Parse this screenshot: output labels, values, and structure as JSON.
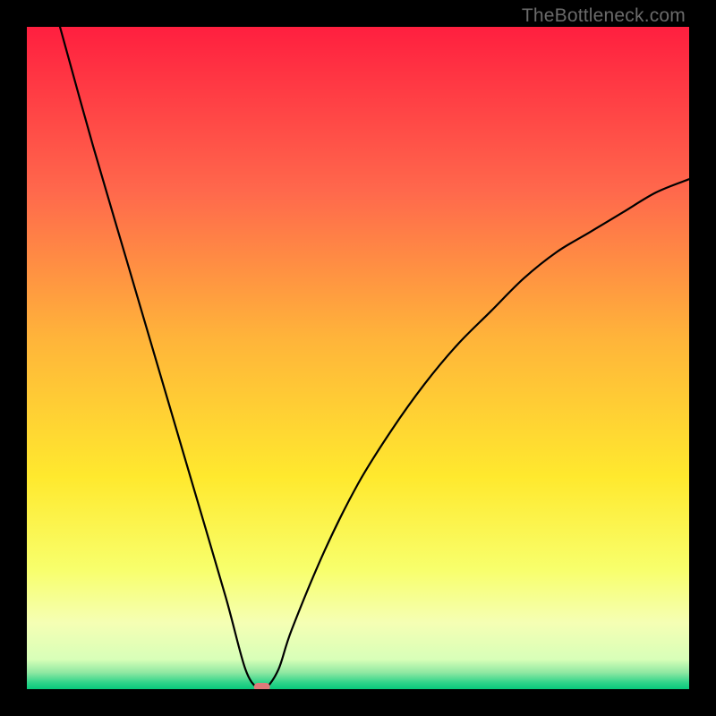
{
  "watermark": "TheBottleneck.com",
  "chart_data": {
    "type": "line",
    "title": "",
    "xlabel": "",
    "ylabel": "",
    "xlim": [
      0,
      100
    ],
    "ylim": [
      0,
      100
    ],
    "x": [
      5,
      10,
      15,
      20,
      25,
      30,
      33,
      35,
      36,
      38,
      40,
      45,
      50,
      55,
      60,
      65,
      70,
      75,
      80,
      85,
      90,
      95,
      100
    ],
    "values": [
      100,
      82,
      65,
      48,
      31,
      14,
      3,
      0,
      0,
      3,
      9,
      21,
      31,
      39,
      46,
      52,
      57,
      62,
      66,
      69,
      72,
      75,
      77
    ],
    "min_marker": {
      "x": 35.5,
      "y": 0
    },
    "gradient_stops": [
      {
        "pos": 0.0,
        "color": "#ff1f3f"
      },
      {
        "pos": 0.25,
        "color": "#ff694c"
      },
      {
        "pos": 0.47,
        "color": "#ffb43a"
      },
      {
        "pos": 0.68,
        "color": "#ffe92e"
      },
      {
        "pos": 0.82,
        "color": "#f8ff6c"
      },
      {
        "pos": 0.9,
        "color": "#f5ffb4"
      },
      {
        "pos": 0.955,
        "color": "#d8ffb8"
      },
      {
        "pos": 0.975,
        "color": "#8fe8a2"
      },
      {
        "pos": 0.99,
        "color": "#30d48a"
      },
      {
        "pos": 1.0,
        "color": "#08c97b"
      }
    ]
  }
}
